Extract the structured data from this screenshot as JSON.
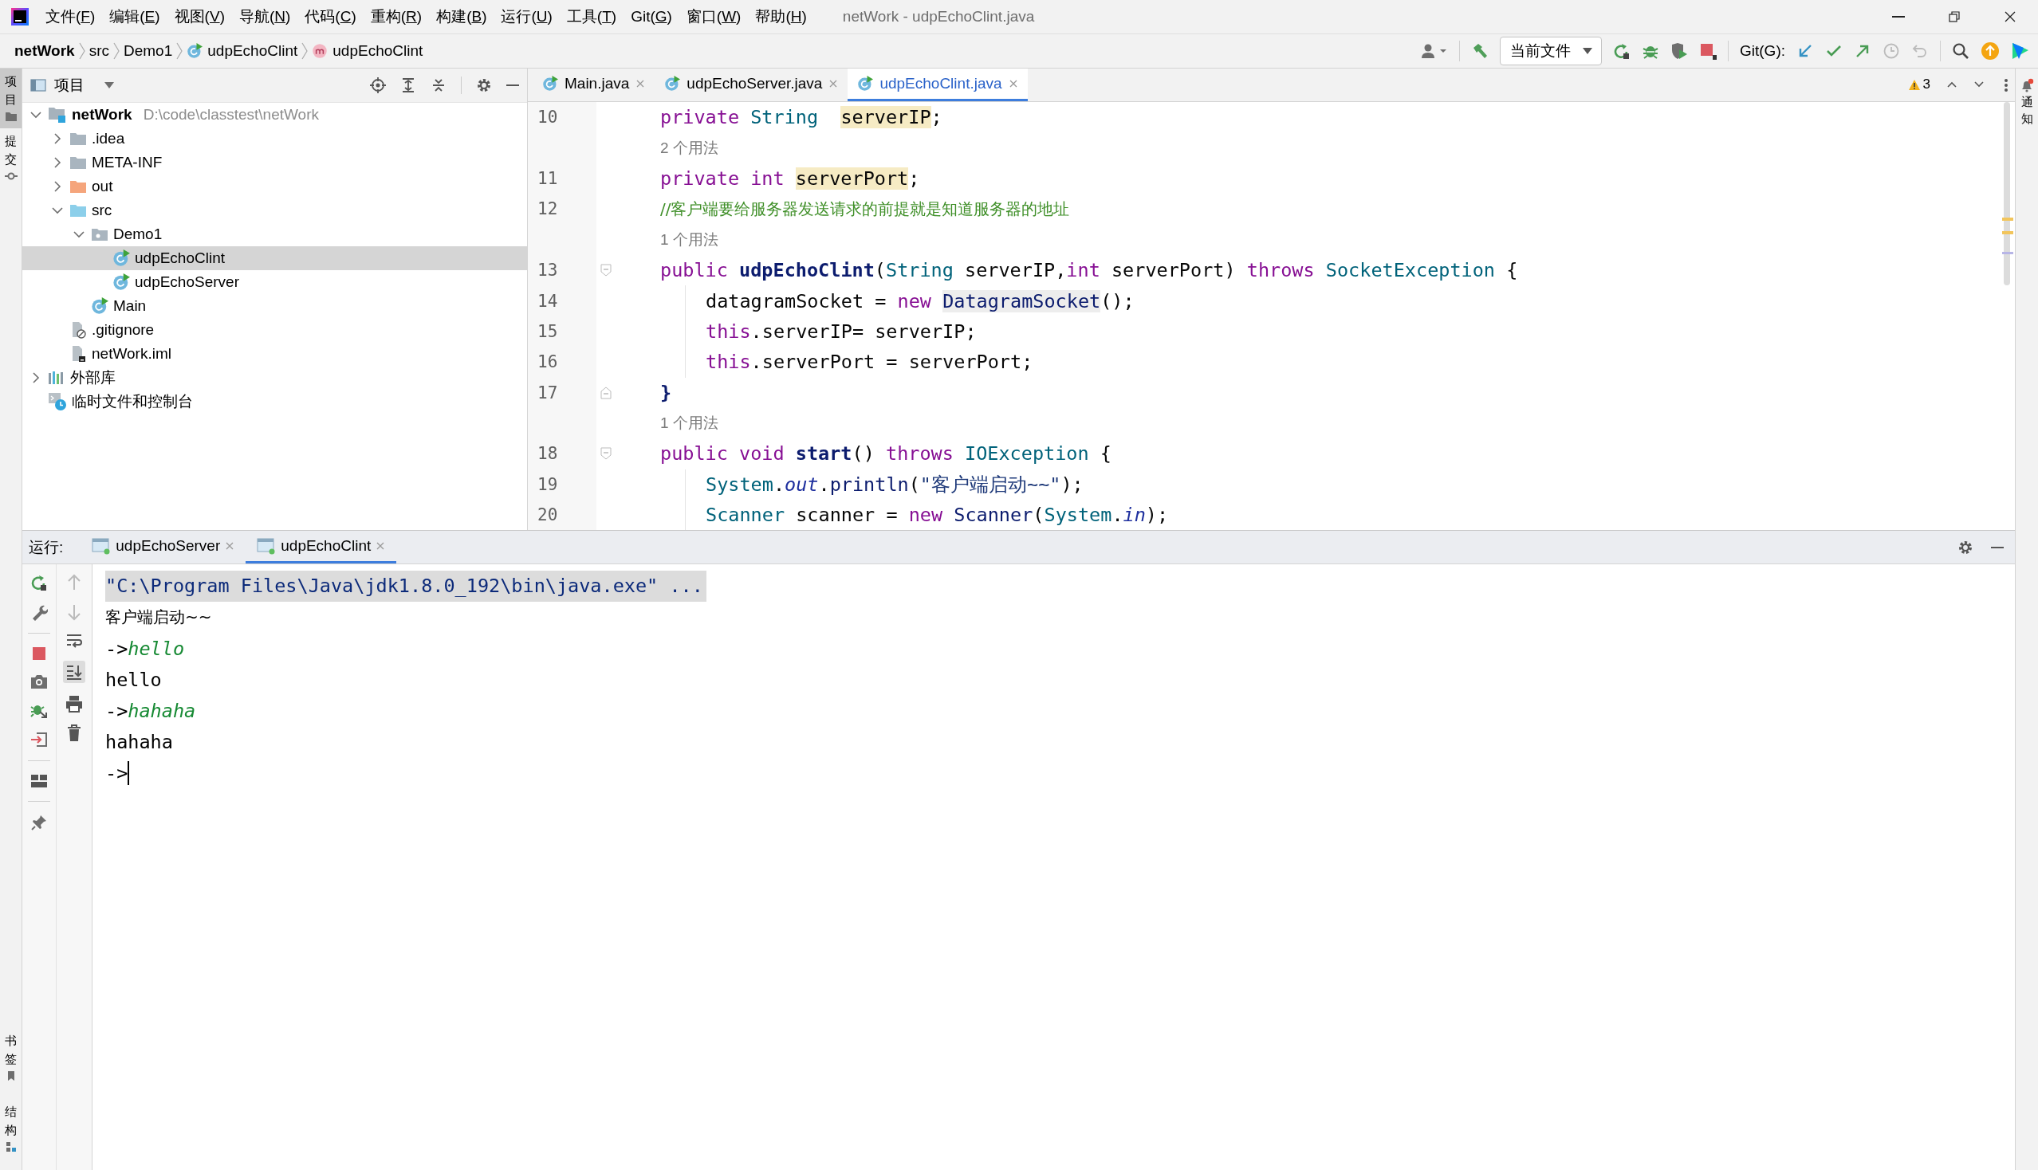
{
  "window": {
    "title": "netWork - udpEchoClint.java"
  },
  "menu": [
    "文件(F)",
    "编辑(E)",
    "视图(V)",
    "导航(N)",
    "代码(C)",
    "重构(R)",
    "构建(B)",
    "运行(U)",
    "工具(T)",
    "Git(G)",
    "窗口(W)",
    "帮助(H)"
  ],
  "breadcrumb": [
    {
      "text": "netWork",
      "kind": "project"
    },
    {
      "text": "src",
      "kind": "folder"
    },
    {
      "text": "Demo1",
      "kind": "folder"
    },
    {
      "text": "udpEchoClint",
      "kind": "class"
    },
    {
      "text": "udpEchoClint",
      "kind": "method"
    }
  ],
  "toolbar": {
    "run_config": "当前文件",
    "vcs_label": "Git(G):"
  },
  "left_strip": {
    "top": [
      {
        "label": "项目",
        "selected": true
      },
      {
        "label": "提交",
        "selected": false
      }
    ],
    "bottom": [
      {
        "label": "书签",
        "selected": false
      },
      {
        "label": "结构",
        "selected": false
      }
    ]
  },
  "right_strip": {
    "label": "通知"
  },
  "project": {
    "title": "项目",
    "tree": [
      {
        "label": "netWork",
        "path": "D:\\code\\classtest\\netWork",
        "kind": "project",
        "expanded": true,
        "selected": false,
        "children": [
          {
            "label": ".idea",
            "kind": "folder",
            "expanded": false,
            "selected": false
          },
          {
            "label": "META-INF",
            "kind": "folder",
            "expanded": false,
            "selected": false
          },
          {
            "label": "out",
            "kind": "excluded",
            "expanded": false,
            "selected": false
          },
          {
            "label": "src",
            "kind": "source",
            "expanded": true,
            "selected": false,
            "children": [
              {
                "label": "Demo1",
                "kind": "package",
                "expanded": true,
                "selected": false,
                "children": [
                  {
                    "label": "udpEchoClint",
                    "kind": "class",
                    "selected": true
                  },
                  {
                    "label": "udpEchoServer",
                    "kind": "class",
                    "selected": false
                  }
                ]
              },
              {
                "label": "Main",
                "kind": "class",
                "selected": false
              }
            ]
          },
          {
            "label": ".gitignore",
            "kind": "ignore",
            "selected": false
          },
          {
            "label": "netWork.iml",
            "kind": "module",
            "selected": false
          }
        ]
      },
      {
        "label": "外部库",
        "kind": "library",
        "expanded": false,
        "selected": false
      },
      {
        "label": "临时文件和控制台",
        "kind": "scratch",
        "selected": false
      }
    ]
  },
  "editor": {
    "tabs": [
      {
        "label": "Main.java",
        "selected": false
      },
      {
        "label": "udpEchoServer.java",
        "selected": false
      },
      {
        "label": "udpEchoClint.java",
        "selected": true
      }
    ],
    "warnings": "3",
    "lines": [
      {
        "kind": "code",
        "number": "10",
        "tokens": [
          {
            "kind": "kw",
            "t": "private "
          },
          {
            "kind": "type",
            "t": "String  "
          },
          {
            "kind": "field",
            "t": "serverIP"
          },
          {
            "kind": "plain",
            "t": ";"
          }
        ]
      },
      {
        "kind": "hint",
        "text": "2 个用法"
      },
      {
        "kind": "code",
        "number": "11",
        "tokens": [
          {
            "kind": "kw",
            "t": "private int "
          },
          {
            "kind": "field",
            "t": "serverPort"
          },
          {
            "kind": "plain",
            "t": ";"
          }
        ]
      },
      {
        "kind": "code",
        "number": "12",
        "tokens": [
          {
            "kind": "comment",
            "t": "//客户端要给服务器发送请求的前提就是知道服务器的地址"
          }
        ]
      },
      {
        "kind": "hint",
        "text": "1 个用法"
      },
      {
        "kind": "code",
        "number": "13",
        "fold_start": true,
        "tokens": [
          {
            "kind": "kw",
            "t": "public "
          },
          {
            "kind": "fn",
            "t": "udpEchoClint"
          },
          {
            "kind": "plain",
            "t": "("
          },
          {
            "kind": "type",
            "t": "String"
          },
          {
            "kind": "plain",
            "t": " serverIP,"
          },
          {
            "kind": "kw",
            "t": "int"
          },
          {
            "kind": "plain",
            "t": " serverPort) "
          },
          {
            "kind": "kw",
            "t": "throws "
          },
          {
            "kind": "type",
            "t": "SocketException"
          },
          {
            "kind": "plain",
            "t": " {"
          }
        ]
      },
      {
        "kind": "code",
        "number": "14",
        "nested": true,
        "tokens": [
          {
            "kind": "plain",
            "t": "datagramSocket = "
          },
          {
            "kind": "kw",
            "t": "new "
          },
          {
            "kind": "ref",
            "t": "DatagramSocket"
          },
          {
            "kind": "plain",
            "t": "();"
          }
        ]
      },
      {
        "kind": "code",
        "number": "15",
        "nested": true,
        "tokens": [
          {
            "kind": "kw",
            "t": "this"
          },
          {
            "kind": "plain",
            "t": ".serverIP= serverIP;"
          }
        ]
      },
      {
        "kind": "code",
        "number": "16",
        "nested": true,
        "tokens": [
          {
            "kind": "kw",
            "t": "this"
          },
          {
            "kind": "plain",
            "t": ".serverPort = serverPort;"
          }
        ]
      },
      {
        "kind": "code",
        "number": "17",
        "fold_end": true,
        "tokens": [
          {
            "kind": "fn",
            "t": "}"
          }
        ]
      },
      {
        "kind": "hint",
        "text": "1 个用法"
      },
      {
        "kind": "code",
        "number": "18",
        "fold_start": true,
        "tokens": [
          {
            "kind": "kw",
            "t": "public void "
          },
          {
            "kind": "fn",
            "t": "start"
          },
          {
            "kind": "plain",
            "t": "() "
          },
          {
            "kind": "kw",
            "t": "throws "
          },
          {
            "kind": "type",
            "t": "IOException"
          },
          {
            "kind": "plain",
            "t": " {"
          }
        ]
      },
      {
        "kind": "code",
        "number": "19",
        "nested": true,
        "tokens": [
          {
            "kind": "type",
            "t": "System"
          },
          {
            "kind": "plain",
            "t": "."
          },
          {
            "kind": "static",
            "t": "out"
          },
          {
            "kind": "plain",
            "t": "."
          },
          {
            "kind": "call",
            "t": "println"
          },
          {
            "kind": "plain",
            "t": "("
          },
          {
            "kind": "string",
            "t": "\"客户端启动~~\""
          },
          {
            "kind": "plain",
            "t": ");"
          }
        ]
      },
      {
        "kind": "code",
        "number": "20",
        "nested": true,
        "tokens": [
          {
            "kind": "type",
            "t": "Scanner"
          },
          {
            "kind": "plain",
            "t": " scanner = "
          },
          {
            "kind": "kw",
            "t": "new "
          },
          {
            "kind": "call",
            "t": "Scanner"
          },
          {
            "kind": "plain",
            "t": "("
          },
          {
            "kind": "type",
            "t": "System"
          },
          {
            "kind": "plain",
            "t": "."
          },
          {
            "kind": "static",
            "t": "in"
          },
          {
            "kind": "plain",
            "t": ");"
          }
        ]
      }
    ]
  },
  "run": {
    "label": "运行:",
    "tabs": [
      {
        "label": "udpEchoServer",
        "selected": false
      },
      {
        "label": "udpEchoClint",
        "selected": true
      }
    ],
    "output": [
      {
        "kind": "command",
        "text": "\"C:\\Program Files\\Java\\jdk1.8.0_192\\bin\\java.exe\" ..."
      },
      {
        "kind": "output",
        "text": "客户端启动~~"
      },
      {
        "kind": "prompt",
        "prompt": "->",
        "input": "hello",
        "cursor": false
      },
      {
        "kind": "output",
        "text": "hello"
      },
      {
        "kind": "prompt",
        "prompt": "->",
        "input": "hahaha",
        "cursor": false
      },
      {
        "kind": "output",
        "text": "hahaha"
      },
      {
        "kind": "prompt",
        "prompt": "->",
        "cursor": true
      }
    ]
  }
}
